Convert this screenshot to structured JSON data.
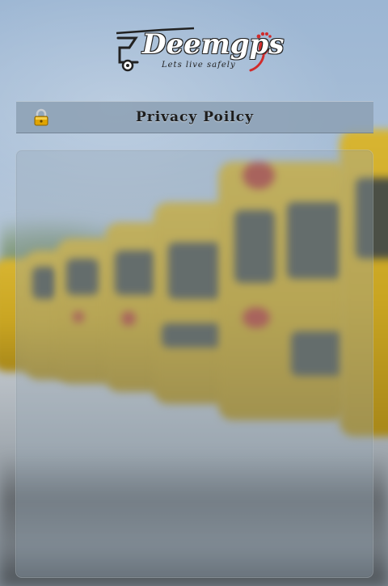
{
  "header": {
    "logo": {
      "name": "Deemgps",
      "tagline": "Lets live safely",
      "icon": "bus-footprint-logo"
    }
  },
  "title_bar": {
    "icon": "lock-icon",
    "title": "Privacy Poilcy"
  },
  "content": {
    "body": ""
  },
  "colors": {
    "title_bar_bg": "#8ca0b4",
    "logo_accent": "#d12b2b",
    "bus_yellow": "#d8b531"
  }
}
